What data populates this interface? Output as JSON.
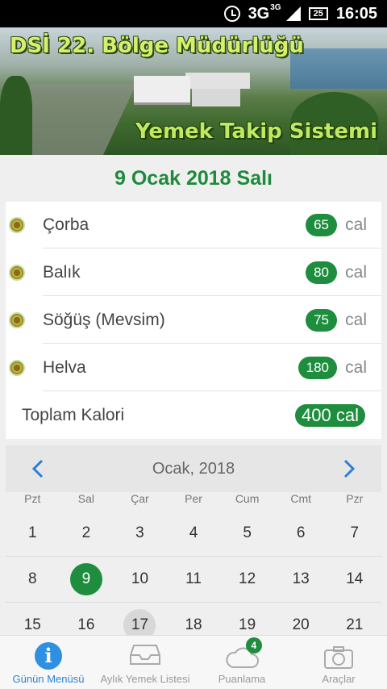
{
  "status_bar": {
    "network": "3G",
    "network_super": "3G",
    "battery": "25",
    "time": "16:05"
  },
  "banner": {
    "title": "DSİ 22. Bölge Müdürlüğü",
    "subtitle": "Yemek Takip Sistemi"
  },
  "date_heading": "9 Ocak 2018 Salı",
  "menu": {
    "items": [
      {
        "name": "Çorba",
        "calories": "65",
        "unit": "cal"
      },
      {
        "name": "Balık",
        "calories": "80",
        "unit": "cal"
      },
      {
        "name": "Söğüş (Mevsim)",
        "calories": "75",
        "unit": "cal"
      },
      {
        "name": "Helva",
        "calories": "180",
        "unit": "cal"
      }
    ],
    "total_label": "Toplam Kalori",
    "total_value": "400 cal"
  },
  "calendar": {
    "month_label": "Ocak, 2018",
    "weekdays": [
      "Pzt",
      "Sal",
      "Çar",
      "Per",
      "Cum",
      "Cmt",
      "Pzr"
    ],
    "rows": [
      [
        "1",
        "2",
        "3",
        "4",
        "5",
        "6",
        "7"
      ],
      [
        "8",
        "9",
        "10",
        "11",
        "12",
        "13",
        "14"
      ],
      [
        "15",
        "16",
        "17",
        "18",
        "19",
        "20",
        "21"
      ]
    ],
    "selected_day": "9",
    "today_day": "17"
  },
  "bottom_nav": {
    "items": [
      {
        "label": "Günün Menüsü",
        "icon": "info-icon"
      },
      {
        "label": "Aylık Yemek Listesi",
        "icon": "inbox-icon"
      },
      {
        "label": "Puanlama",
        "icon": "cloud-icon",
        "badge": "4"
      },
      {
        "label": "Araçlar",
        "icon": "camera-icon"
      }
    ]
  },
  "colors": {
    "accent_green": "#1e8e3e",
    "active_blue": "#2b82d3",
    "heading_green": "#1f8a3b"
  }
}
